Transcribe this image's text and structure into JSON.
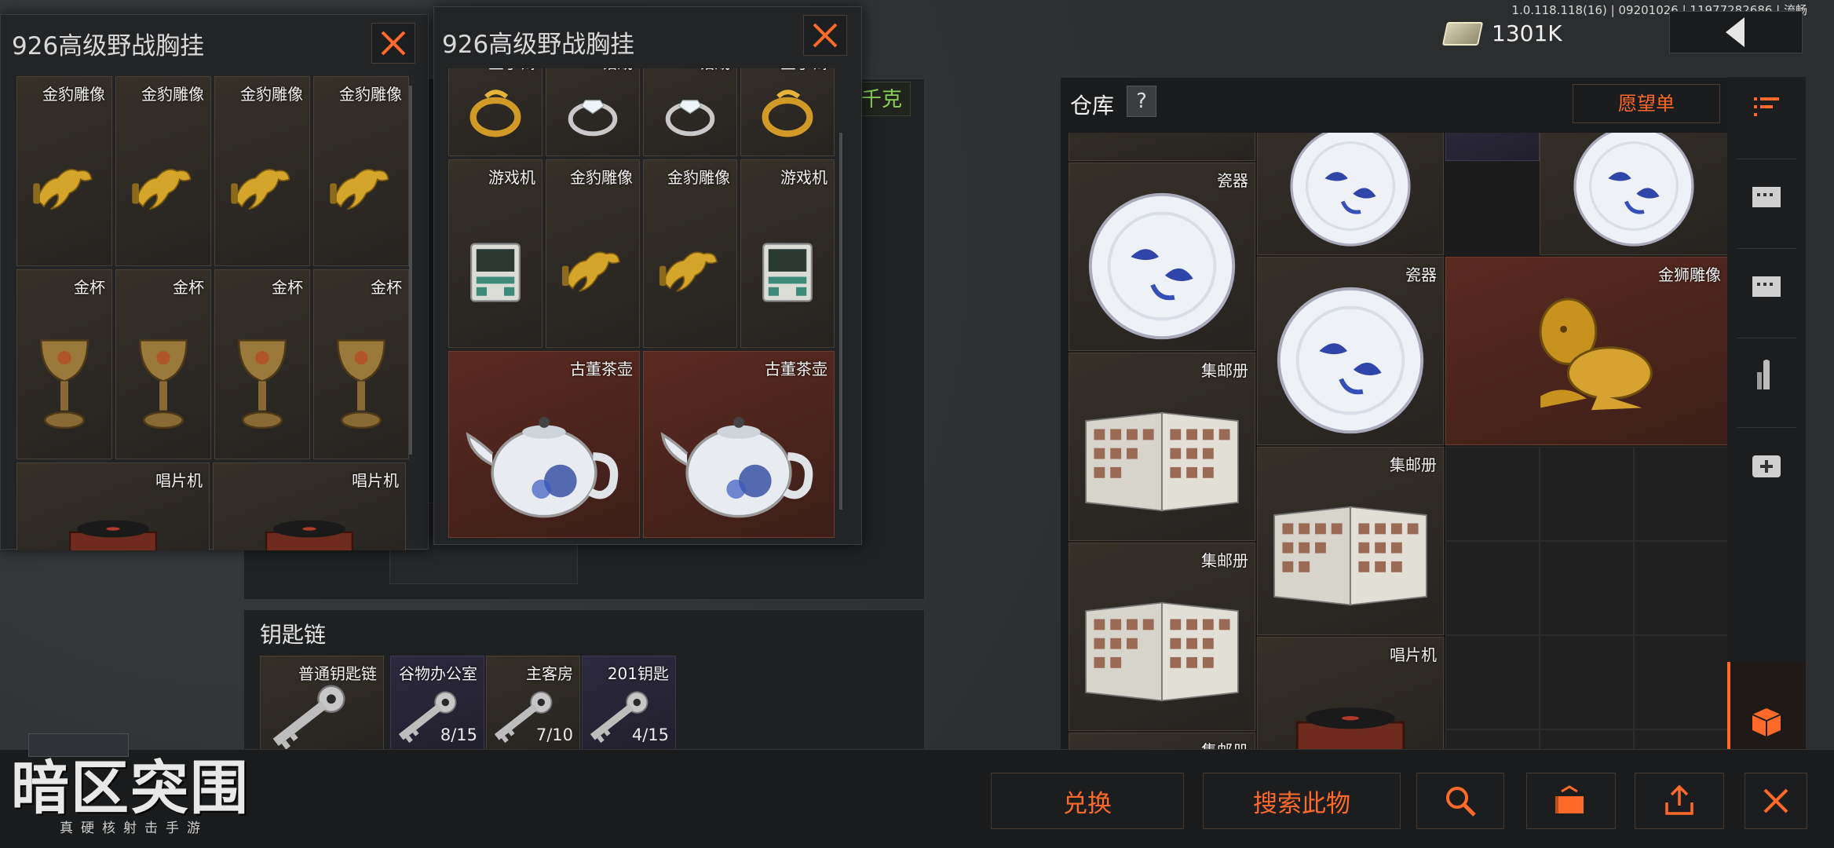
{
  "status_bar": {
    "version": "1.0.118.118(16) | 09201026 | 11977282686 | 流畅",
    "money": "1301K"
  },
  "icons": {
    "cash": "cash-stack-icon",
    "back": "chevron-left-icon",
    "close": "close-icon"
  },
  "popup_left": {
    "title": "926高级野战胸挂",
    "items": [
      {
        "label": "金豹雕像",
        "kind": "leopard"
      },
      {
        "label": "金豹雕像",
        "kind": "leopard"
      },
      {
        "label": "金豹雕像",
        "kind": "leopard"
      },
      {
        "label": "金豹雕像",
        "kind": "leopard"
      },
      {
        "label": "金杯",
        "kind": "cup"
      },
      {
        "label": "金杯",
        "kind": "cup"
      },
      {
        "label": "金杯",
        "kind": "cup"
      },
      {
        "label": "金杯",
        "kind": "cup"
      },
      {
        "label": "唱片机",
        "kind": "phonograph"
      },
      {
        "label": "唱片机",
        "kind": "phonograph"
      }
    ]
  },
  "popup_right": {
    "title": "926高级野战胸挂",
    "items": [
      {
        "label": "金手镯",
        "kind": "bracelet"
      },
      {
        "label": "钻戒",
        "kind": "ring"
      },
      {
        "label": "钻戒",
        "kind": "ring"
      },
      {
        "label": "金手镯",
        "kind": "bracelet"
      },
      {
        "label": "游戏机",
        "kind": "gameboy"
      },
      {
        "label": "金豹雕像",
        "kind": "leopard"
      },
      {
        "label": "金豹雕像",
        "kind": "leopard"
      },
      {
        "label": "游戏机",
        "kind": "gameboy"
      },
      {
        "label": "古董茶壶",
        "kind": "teapot"
      },
      {
        "label": "古董茶壶",
        "kind": "teapot"
      }
    ]
  },
  "background_tabs": {
    "kg_label": "千克"
  },
  "warehouse": {
    "title": "仓库",
    "help": "?",
    "wishlist_button": "愿望单",
    "items": [
      {
        "label": "瓷器",
        "kind": "plate"
      },
      {
        "label": "",
        "kind": "plate"
      },
      {
        "label": "",
        "kind": "plate"
      },
      {
        "label": "瓷器",
        "kind": "plate"
      },
      {
        "label": "金狮雕像",
        "kind": "lion"
      },
      {
        "label": "集邮册",
        "kind": "album"
      },
      {
        "label": "集邮册",
        "kind": "album"
      },
      {
        "label": "集邮册",
        "kind": "album"
      },
      {
        "label": "唱片机",
        "kind": "phonograph"
      },
      {
        "label": "集邮册",
        "kind": "album"
      }
    ],
    "sidebar_icons": [
      "list-grid-icon",
      "storage-box-icon",
      "storage-box-icon",
      "ammo-icon",
      "medkit-icon",
      "cube-icon"
    ]
  },
  "keychain": {
    "title": "钥匙链",
    "keys": [
      {
        "label": "普通钥匙链",
        "count": ""
      },
      {
        "label": "谷物办公室",
        "count": "8/15"
      },
      {
        "label": "主客房",
        "count": "7/10"
      },
      {
        "label": "201钥匙",
        "count": "4/15"
      }
    ]
  },
  "bottom_bar": {
    "exchange": "兑换",
    "search_item": "搜索此物",
    "search_icon": "magnifier-icon",
    "transfer_icon": "transfer-box-icon",
    "upload_icon": "upload-icon",
    "close_icon": "close-icon"
  },
  "logo": {
    "title": "暗区突围",
    "subtitle": "真硬核射击手游"
  },
  "colors": {
    "accent": "#ff6a2a",
    "gold_cell": "#3f331b",
    "red_cell": "#4a251d",
    "green_text": "#8ad158"
  }
}
